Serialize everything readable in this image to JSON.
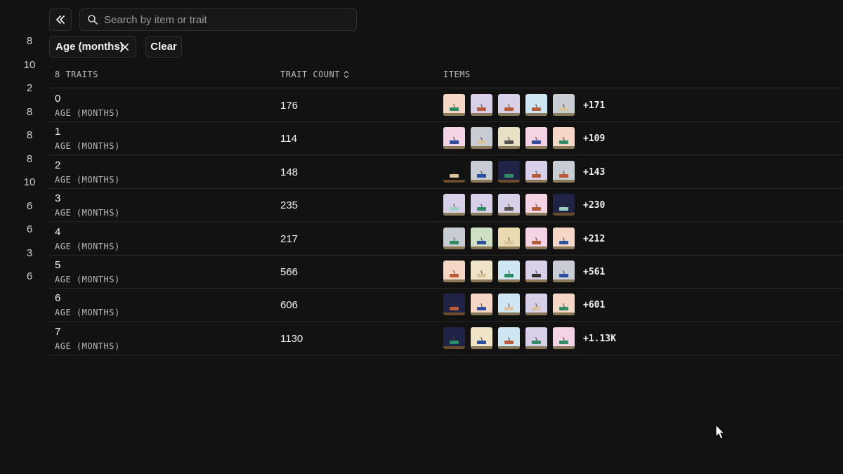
{
  "left_numbers": [
    "8",
    "10",
    "2",
    "8",
    "8",
    "8",
    "10",
    "6",
    "6",
    "3",
    "6"
  ],
  "search": {
    "placeholder": "Search by item or trait",
    "value": ""
  },
  "filter_chip": {
    "label": "Age (months)"
  },
  "clear_label": "Clear",
  "headers": {
    "traits": "8 TRAITS",
    "count": "TRAIT COUNT",
    "items": "ITEMS"
  },
  "rows": [
    {
      "value": "0",
      "sub": "AGE (MONTHS)",
      "count": "176",
      "more": "+171",
      "thumbs": [
        [
          "#f6d6c4",
          "#2f8c67"
        ],
        [
          "#d8cfe8",
          "#b85c3a"
        ],
        [
          "#d8cfe8",
          "#b85c3a"
        ],
        [
          "#cfe6f3",
          "#b85c3a"
        ],
        [
          "#c7cdd3",
          "#d9c49f"
        ]
      ]
    },
    {
      "value": "1",
      "sub": "AGE (MONTHS)",
      "count": "114",
      "more": "+109",
      "thumbs": [
        [
          "#f4d3e4",
          "#2e4fa0"
        ],
        [
          "#c7cdd3",
          "#d9c49f"
        ],
        [
          "#e7e0c4",
          "#555555"
        ],
        [
          "#f4d3e4",
          "#2e4fa0"
        ],
        [
          "#f6d6c4",
          "#2f8c67"
        ]
      ]
    },
    {
      "value": "2",
      "sub": "AGE (MONTHS)",
      "count": "148",
      "more": "+143",
      "thumbs": [
        [
          "#111111",
          "#d9c49f"
        ],
        [
          "#c7cdd3",
          "#2e4fa0"
        ],
        [
          "#1f2345",
          "#2f8c67"
        ],
        [
          "#d8cfe8",
          "#b85c3a"
        ],
        [
          "#c7cdd3",
          "#b85c3a"
        ]
      ]
    },
    {
      "value": "3",
      "sub": "AGE (MONTHS)",
      "count": "235",
      "more": "+230",
      "thumbs": [
        [
          "#d8cfe8",
          "#9bd0c8"
        ],
        [
          "#d8cfe8",
          "#2f8c67"
        ],
        [
          "#d8cfe8",
          "#555555"
        ],
        [
          "#f4d3e4",
          "#b85c3a"
        ],
        [
          "#1f2345",
          "#9bd0c8"
        ]
      ]
    },
    {
      "value": "4",
      "sub": "AGE (MONTHS)",
      "count": "217",
      "more": "+212",
      "thumbs": [
        [
          "#c7cdd3",
          "#2f8c67"
        ],
        [
          "#cde0c4",
          "#2e4fa0"
        ],
        [
          "#e9dcb0",
          "#d9c49f"
        ],
        [
          "#f4d3e4",
          "#b85c3a"
        ],
        [
          "#f6d6c4",
          "#2e4fa0"
        ]
      ]
    },
    {
      "value": "5",
      "sub": "AGE (MONTHS)",
      "count": "566",
      "more": "+561",
      "thumbs": [
        [
          "#f6d6c4",
          "#b85c3a"
        ],
        [
          "#efe3c8",
          "#d9c49f"
        ],
        [
          "#cfe6f3",
          "#2f8c67"
        ],
        [
          "#d8cfe8",
          "#333333"
        ],
        [
          "#c7cdd3",
          "#2e4fa0"
        ]
      ]
    },
    {
      "value": "6",
      "sub": "AGE (MONTHS)",
      "count": "606",
      "more": "+601",
      "thumbs": [
        [
          "#1f2345",
          "#b85c3a"
        ],
        [
          "#f6d6c4",
          "#2e4fa0"
        ],
        [
          "#cfe6f3",
          "#d9c49f"
        ],
        [
          "#d8cfe8",
          "#d9c49f"
        ],
        [
          "#f6d6c4",
          "#2f8c67"
        ]
      ]
    },
    {
      "value": "7",
      "sub": "AGE (MONTHS)",
      "count": "1130",
      "more": "+1.13K",
      "thumbs": [
        [
          "#1f2345",
          "#2f8c67"
        ],
        [
          "#efe3c8",
          "#2e4fa0"
        ],
        [
          "#cfe6f3",
          "#b85c3a"
        ],
        [
          "#d8cfe8",
          "#2f8c67"
        ],
        [
          "#f4d3e4",
          "#2f8c67"
        ]
      ]
    }
  ]
}
